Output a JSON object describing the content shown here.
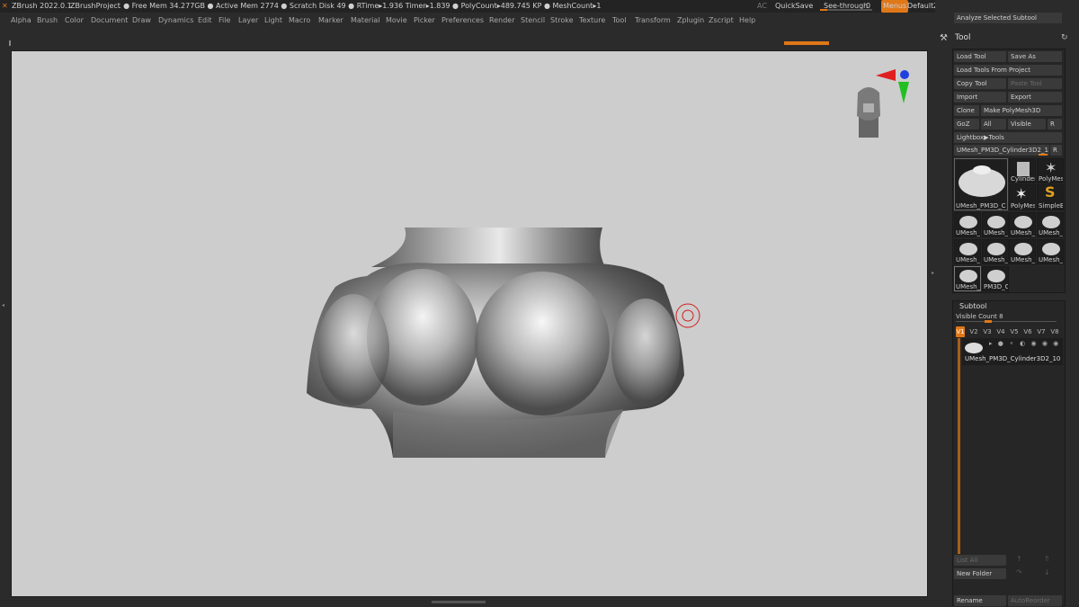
{
  "topbar": {
    "app_title": "ZBrush 2022.0.1",
    "project": "ZBrushProject",
    "stats": ". ● Free Mem 34.277GB ● Active Mem 2774 ● Scratch Disk 49 ● RTime▸1.936 Timer▸1.839 ● PolyCount▸489.745 KP ● MeshCount▸1",
    "ac": "AC",
    "quicksave": "QuickSave",
    "see_through_label": "See-through",
    "see_through_value": "0",
    "menus": "Menus",
    "default_zscript": "DefaultZScript"
  },
  "menubar": {
    "items": [
      "Alpha",
      "Brush",
      "Color",
      "Document",
      "Draw",
      "Dynamics",
      "Edit",
      "File",
      "Layer",
      "Light",
      "Macro",
      "Marker",
      "Material",
      "Movie",
      "Picker",
      "Preferences",
      "Render",
      "Stencil",
      "Stroke",
      "Texture",
      "Tool",
      "Transform",
      "Zplugin",
      "Zscript",
      "Help"
    ]
  },
  "tool_panel": {
    "top_button": "Analyze Selected Subtool",
    "title": "Tool",
    "load_tool": "Load Tool",
    "save_as": "Save As",
    "load_tools_from_project": "Load Tools From Project",
    "copy_tool": "Copy Tool",
    "paste_tool": "Paste Tool",
    "import": "Import",
    "export": "Export",
    "clone": "Clone",
    "make_polymesh": "Make PolyMesh3D",
    "goz": "GoZ",
    "all": "All",
    "visible": "Visible",
    "r": "R",
    "lightbox_tools": "Lightbox▶Tools",
    "current_tool": "UMesh_PM3D_Cylinder3D2_1",
    "current_tool_r": "R",
    "thumbs": {
      "main": "UMesh_PM3D_C",
      "cylinder": "Cylinder",
      "polymesh": "PolyMes",
      "polymesh2": "PolyMes",
      "simpleb": "SimpleB",
      "umesh": "UMesh_",
      "pm3d_c": "PM3D_C"
    }
  },
  "subtool_panel": {
    "title": "Subtool",
    "visible_count": "Visible Count 8",
    "tabs": [
      "V1",
      "V2",
      "V3",
      "V4",
      "V5",
      "V6",
      "V7",
      "V8"
    ],
    "active_tab": "V1",
    "item_name": "UMesh_PM3D_Cylinder3D2_10",
    "list_all": "List All",
    "new_folder": "New Folder",
    "rename": "Rename",
    "auto_reorder": "AutoReorder"
  },
  "colors": {
    "accent": "#e07818",
    "canvas_bg": "#cdcdcd",
    "ui_bg": "#2b2b2b",
    "gizmo_red": "#e02020",
    "gizmo_green": "#20c020",
    "gizmo_blue": "#2040e0"
  },
  "icons": {
    "tool": "hammer-icon",
    "refresh": "refresh-icon",
    "gizmo": "axis-gizmo-icon",
    "head": "navigation-head-icon",
    "cursor": "brush-cursor-icon"
  }
}
